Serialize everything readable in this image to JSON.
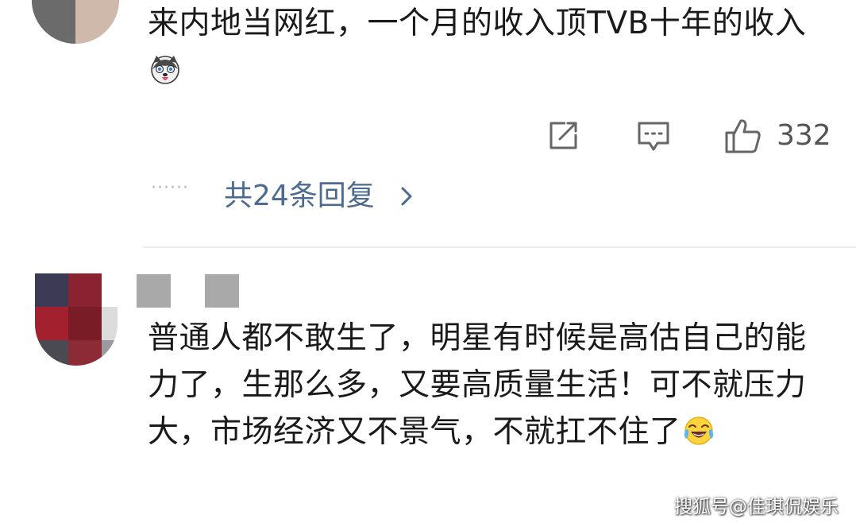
{
  "comment_1": {
    "text": "来内地当网红，一个月的收入顶TVB十年的收入",
    "emoji_icon": "husky-dog-emoji",
    "like_count": "332",
    "replies_link": "共24条回复",
    "dots": "······"
  },
  "comment_2": {
    "text": "普通人都不敢生了，明星有时候是高估自己的能力了，生那么多，又要高质量生活！可不就压力大，市场经济又不景气，不就扛不住了",
    "emoji_icon": "laughing-crying-emoji"
  },
  "watermark": "搜狐号@佳琪侃娱乐",
  "colors": {
    "text": "#1a1a1a",
    "link": "#4d6a8f",
    "icon": "#666666",
    "divider": "#ececec",
    "name_redacted": "#a9a9a9"
  }
}
